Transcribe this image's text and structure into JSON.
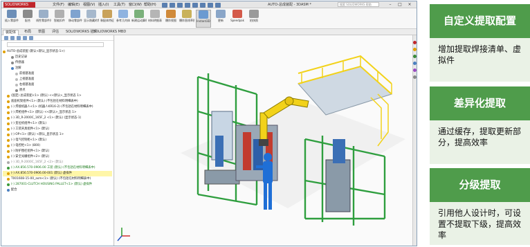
{
  "app": {
    "logo_text": "SOLIDWORKS",
    "menu": [
      "文件(F)",
      "编辑(E)",
      "视图(V)",
      "插入(I)",
      "工具(T)",
      "窗口(W)",
      "帮助(H)"
    ],
    "document_title": "AUTO-总成装配 - 3DASM *",
    "search_placeholder": "搜索 SOLIDWORKS 帮助"
  },
  "ribbon": {
    "buttons": [
      "插入零部件",
      "配合",
      "线性零部件阵列",
      "智能扣件",
      "移动零部件",
      "显示隐藏的零部件",
      "装配体特征",
      "参考几何体",
      "新建运动算例",
      "材料明细表",
      "爆炸视图",
      "爆炸直线草图",
      "Instant3D",
      "更新",
      "Speedpak",
      "拍快照"
    ],
    "active_index": 12
  },
  "tabs": {
    "items": [
      "装配体",
      "布局",
      "草图",
      "评估",
      "SOLIDWORKS 插件",
      "SOLIDWORKS MBD"
    ],
    "active_index": 0
  },
  "tree": {
    "rows": [
      {
        "text": "AUTO-总成装配 (默认<默认_显示状态-1>)",
        "style": "normal",
        "indent": 0,
        "dot": "#e0a000"
      },
      {
        "text": "历史记录",
        "style": "normal",
        "indent": 2,
        "dot": "#888888"
      },
      {
        "text": "传感器",
        "style": "normal",
        "indent": 2,
        "dot": "#888888"
      },
      {
        "text": "注解",
        "style": "normal",
        "indent": 2,
        "dot": "#4a7fc0"
      },
      {
        "text": "前视基准面",
        "style": "normal",
        "indent": 3,
        "dot": "#bbbbbb"
      },
      {
        "text": "上视基准面",
        "style": "normal",
        "indent": 3,
        "dot": "#bbbbbb"
      },
      {
        "text": "右视基准面",
        "style": "normal",
        "indent": 3,
        "dot": "#bbbbbb"
      },
      {
        "text": "原点",
        "style": "normal",
        "indent": 3,
        "dot": "#888888"
      },
      {
        "text": "(固定) 总成装配<1> (默认) <<默认>_显示状态 1>",
        "style": "normal",
        "indent": 1,
        "dot": "#e0a000"
      },
      {
        "text": "底座机架组件<1> (默认) (不包括在材料明细表中)",
        "style": "normal",
        "indent": 1,
        "dot": "#e0a000"
      },
      {
        "text": "(-) 焊接机器人<1> (机器人KR16-2) (不包括在材料明细表中)",
        "style": "normal",
        "indent": 1,
        "dot": "#e0a000"
      },
      {
        "text": "(-) 焊枪组件<1> (默认) <<默认>_显示状态 1>",
        "style": "normal",
        "indent": 1,
        "dot": "#e0a000"
      },
      {
        "text": "(-) 3D_R-2000C_165F_2 <1> (默认) (显示状态-1)",
        "style": "normal",
        "indent": 1,
        "dot": "#e0a000"
      },
      {
        "text": "(-) 变位机组件<1> (默认)",
        "style": "normal",
        "indent": 1,
        "dot": "#e0a000"
      },
      {
        "text": "(-) 工装夹具组件<1> (默认)",
        "style": "normal",
        "indent": 1,
        "dot": "#e0a000"
      },
      {
        "text": "(-) OP<1> (默认) <默认_显示状态 1>",
        "style": "normal",
        "indent": 1,
        "dot": "#e0a000"
      },
      {
        "text": "(-) 电气控制柜<1> (默认)",
        "style": "normal",
        "indent": 1,
        "dot": "#e0a000"
      },
      {
        "text": "(-) 电控柜<1> (800)",
        "style": "normal",
        "indent": 1,
        "dot": "#e0a000"
      },
      {
        "text": "(-) 防护围栏组件<1> (默认)",
        "style": "normal",
        "indent": 1,
        "dot": "#e0a000"
      },
      {
        "text": "(-) 安全光栅组件<2> (默认)",
        "style": "normal",
        "indent": 1,
        "dot": "#e0a000"
      },
      {
        "text": "(-) 3D_R-2000C_165F_2 <2> (默认)",
        "style": "gray",
        "indent": 1,
        "dot": "#aaaaaa"
      },
      {
        "text": "(-) AX.856.570-0906.00 工装 (默认) (不包括在材料明细表中)",
        "style": "green",
        "indent": 1,
        "dot": "#3a9a3a"
      },
      {
        "text": "(-) AX.856.570-0906.00-001 (默认) 虚拟件",
        "style": "hl",
        "indent": 1,
        "dot": "#e0a000"
      },
      {
        "text": "T001608-15-00_asm<1> (默认) (不包括在材料明细表中)",
        "style": "normal",
        "indent": 1,
        "dot": "#e0a000"
      },
      {
        "text": "(-) 287001-CLUTCH HOUSING PALLET<1> (默认) 虚拟件",
        "style": "green",
        "indent": 1,
        "dot": "#3a9a3a"
      },
      {
        "text": "配合",
        "style": "normal",
        "indent": 1,
        "dot": "#4a7fc0"
      }
    ]
  },
  "panel": {
    "cards": [
      {
        "title": "自定义提取配置",
        "body": "增加提取焊接清单、虚拟件"
      },
      {
        "title": "差异化提取",
        "body": "通过缓存，提取更新部分，提高效率"
      },
      {
        "title": "分级提取",
        "body": "引用他人设计时，可设置不提取下级，提高效率"
      }
    ]
  },
  "colors": {
    "accent_green": "#4f9c4b",
    "card_body_bg": "#eaf2e6",
    "frame_green": "#2e9e3e",
    "robot_yellow": "#f2d21a",
    "worker_blue": "#1f6fd6"
  }
}
